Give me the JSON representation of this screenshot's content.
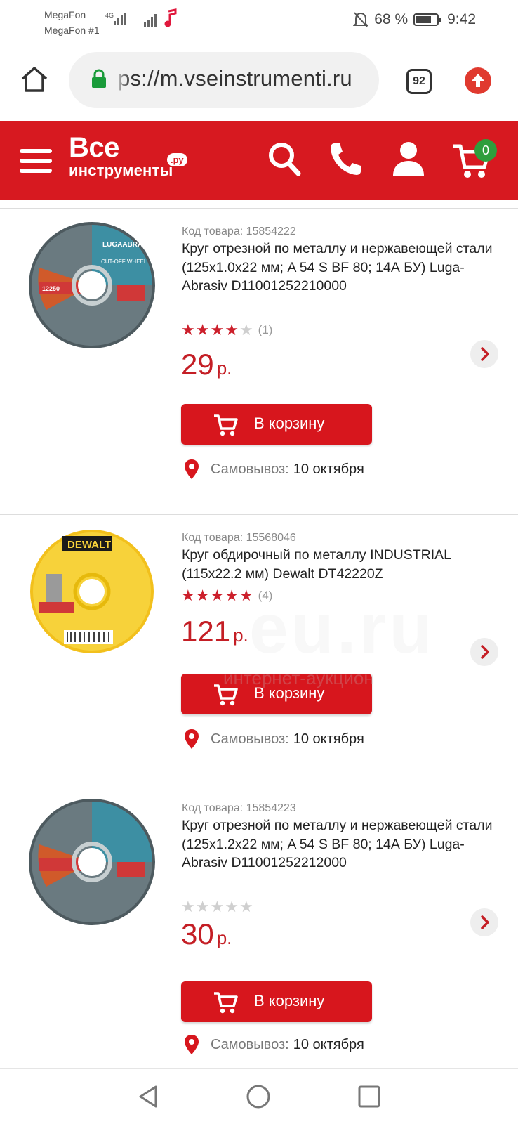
{
  "status_bar": {
    "carrier1": "MegaFon",
    "carrier2": "MegaFon #1",
    "network": "4G",
    "battery": "68 %",
    "time": "9:42"
  },
  "browser": {
    "url": "ps://m.vseinstrumenti.ru",
    "tabs_count": "92"
  },
  "header": {
    "logo_line1": "Все",
    "logo_line2": "инструменты",
    "logo_domain": ".ру",
    "cart_count": "0",
    "brand_color": "#d71920"
  },
  "products": [
    {
      "sku": "Код товара: 15854222",
      "name": "Круг отрезной по металлу и нержавеющей стали (125х1.0х22 мм; A 54 S BF 80; 14А БУ) Luga-Abrasiv D11001252210000",
      "rating": 4,
      "reviews": "(1)",
      "price": "29",
      "currency": "р.",
      "cart_label": "В корзину",
      "pickup_label": "Самовывоз:",
      "pickup_date": "10 октября"
    },
    {
      "sku": "Код товара: 15568046",
      "name": "Круг обдирочный по металлу INDUSTRIAL (115х22.2 мм) Dewalt DT42220Z",
      "rating": 5,
      "reviews": "(4)",
      "price": "121",
      "currency": "р.",
      "cart_label": "В корзину",
      "pickup_label": "Самовывоз:",
      "pickup_date": "10 октября"
    },
    {
      "sku": "Код товара: 15854223",
      "name": "Круг отрезной по металлу и нержавеющей стали (125х1.2х22 мм; A 54 S BF 80; 14А БУ) Luga-Abrasiv D11001252212000",
      "rating": 0,
      "reviews": "",
      "price": "30",
      "currency": "р.",
      "cart_label": "В корзину",
      "pickup_label": "Самовывоз:",
      "pickup_date": "10 октября"
    }
  ],
  "images": {
    "disc1_brand": "LUGAABRASIV",
    "disc1_type": "CUT-OFF WHEEL",
    "disc1_size": "12250",
    "disc2_brand": "DEWALT"
  },
  "watermark": {
    "big": "eu.ru",
    "small": "интернет-аукцион"
  }
}
